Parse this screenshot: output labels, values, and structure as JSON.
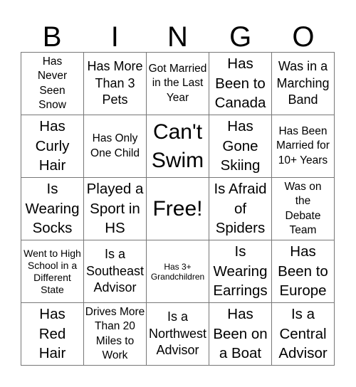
{
  "header": {
    "letters": [
      "B",
      "I",
      "N",
      "G",
      "O"
    ]
  },
  "board": {
    "rows": [
      [
        "Has Never Seen Snow",
        "Has More Than 3 Pets",
        "Got Married in the Last Year",
        "Has Been to Canada",
        "Was in a Marching Band"
      ],
      [
        "Has Curly Hair",
        "Has Only One Child",
        "Can't Swim",
        "Has Gone Skiing",
        "Has Been Married for 10+ Years"
      ],
      [
        "Is Wearing Socks",
        "Played a Sport in HS",
        "Free!",
        "Is Afraid of Spiders",
        "Was on the Debate Team"
      ],
      [
        "Went to High School in a Different State",
        "Is a Southeast Advisor",
        "Has 3+ Grandchildren",
        "Is Wearing Earrings",
        "Has Been to Europe"
      ],
      [
        "Has Red Hair",
        "Drives More Than 20 Miles to Work",
        "Is a Northwest Advisor",
        "Has Been on a Boat",
        "Is a Central Advisor"
      ]
    ]
  }
}
